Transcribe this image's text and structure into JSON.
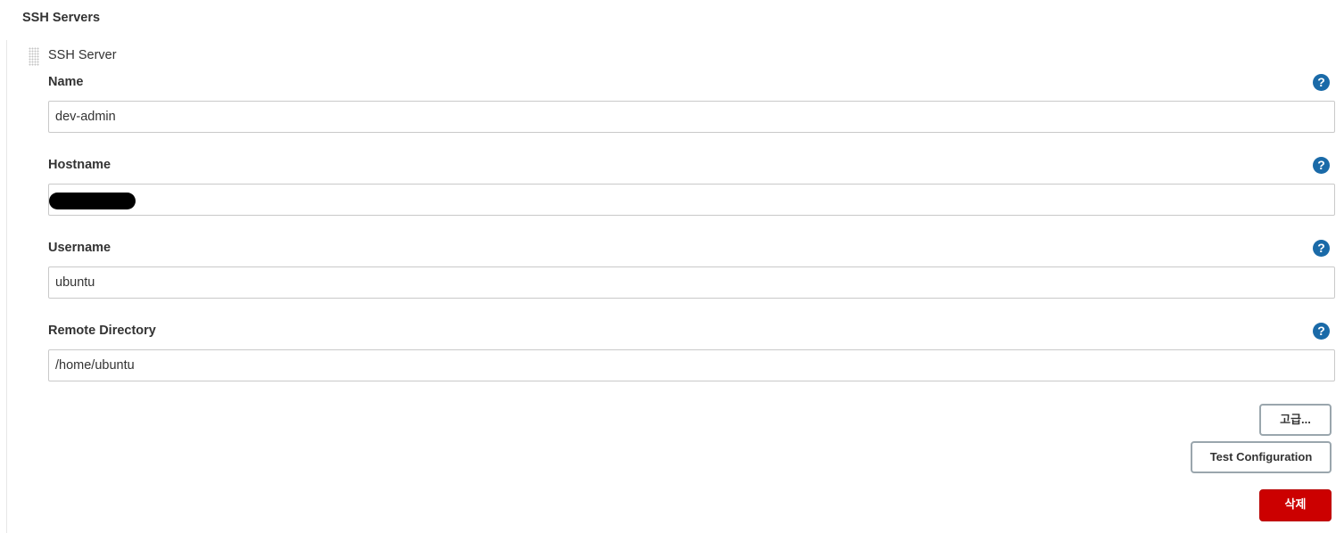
{
  "section": {
    "title": "SSH Servers"
  },
  "server": {
    "title": "SSH Server",
    "fields": [
      {
        "label": "Name",
        "value": "dev-admin",
        "help_icon": "question-circle-icon"
      },
      {
        "label": "Hostname",
        "value": "",
        "value_redacted": true,
        "help_icon": "question-circle-icon"
      },
      {
        "label": "Username",
        "value": "ubuntu",
        "help_icon": "question-circle-icon"
      },
      {
        "label": "Remote Directory",
        "value": "/home/ubuntu",
        "help_icon": "question-circle-icon"
      }
    ],
    "help_glyph": "?"
  },
  "actions": {
    "advanced_label": "고급...",
    "test_label": "Test Configuration",
    "delete_label": "삭제"
  },
  "colors": {
    "help_icon": "#1a6aa8",
    "delete_button": "#cc0000",
    "input_border": "#c9c9c9",
    "button_border": "#9aa6ad"
  }
}
